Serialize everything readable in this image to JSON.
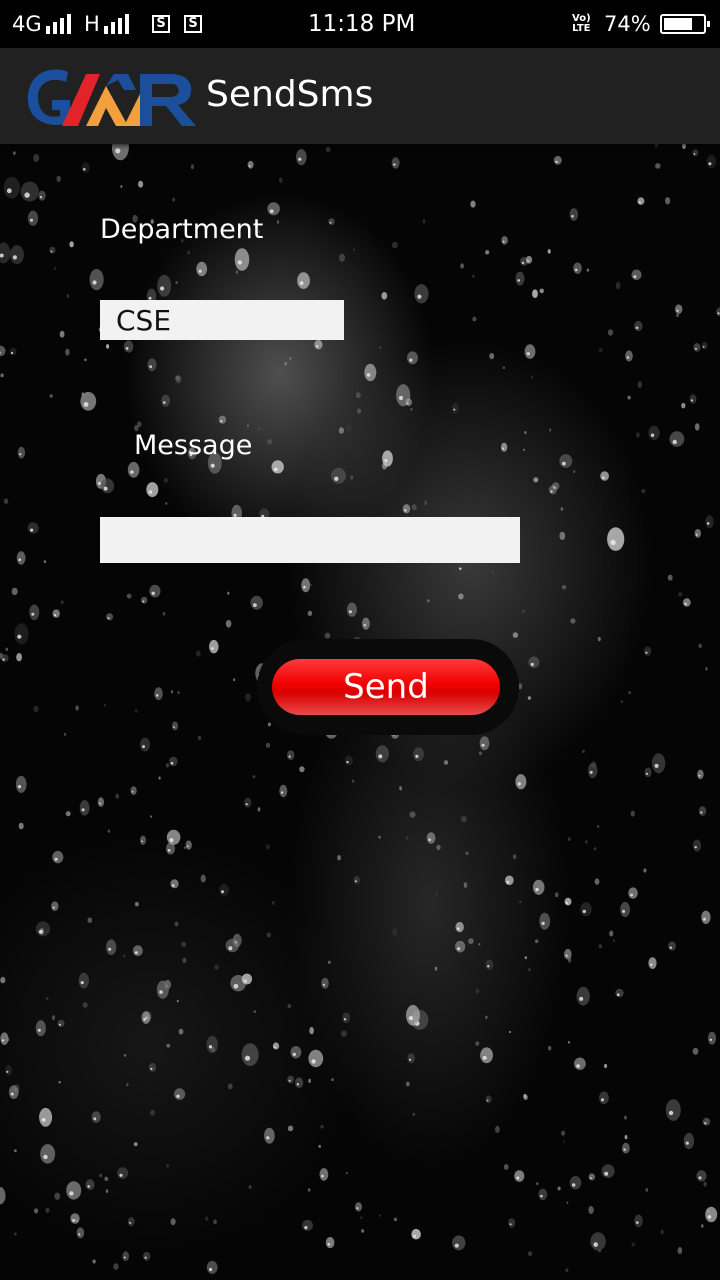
{
  "status_bar": {
    "network_1": "4G",
    "network_2": "H",
    "sim_1": "S",
    "sim_2": "S",
    "time": "11:18 PM",
    "volte_top": "Vo)",
    "volte_bottom": "LTE",
    "battery_percent": "74%",
    "battery_level": 0.74
  },
  "app_bar": {
    "logo_text": "GMR",
    "title": "SendSms"
  },
  "form": {
    "department_label": "Department",
    "department_value": "CSE",
    "message_label": "Message",
    "message_value": "",
    "send_label": "Send"
  },
  "colors": {
    "logo_blue": "#1b4f9c",
    "logo_red": "#e2232a",
    "logo_orange": "#f2a03d",
    "send_button": "#f20000"
  }
}
